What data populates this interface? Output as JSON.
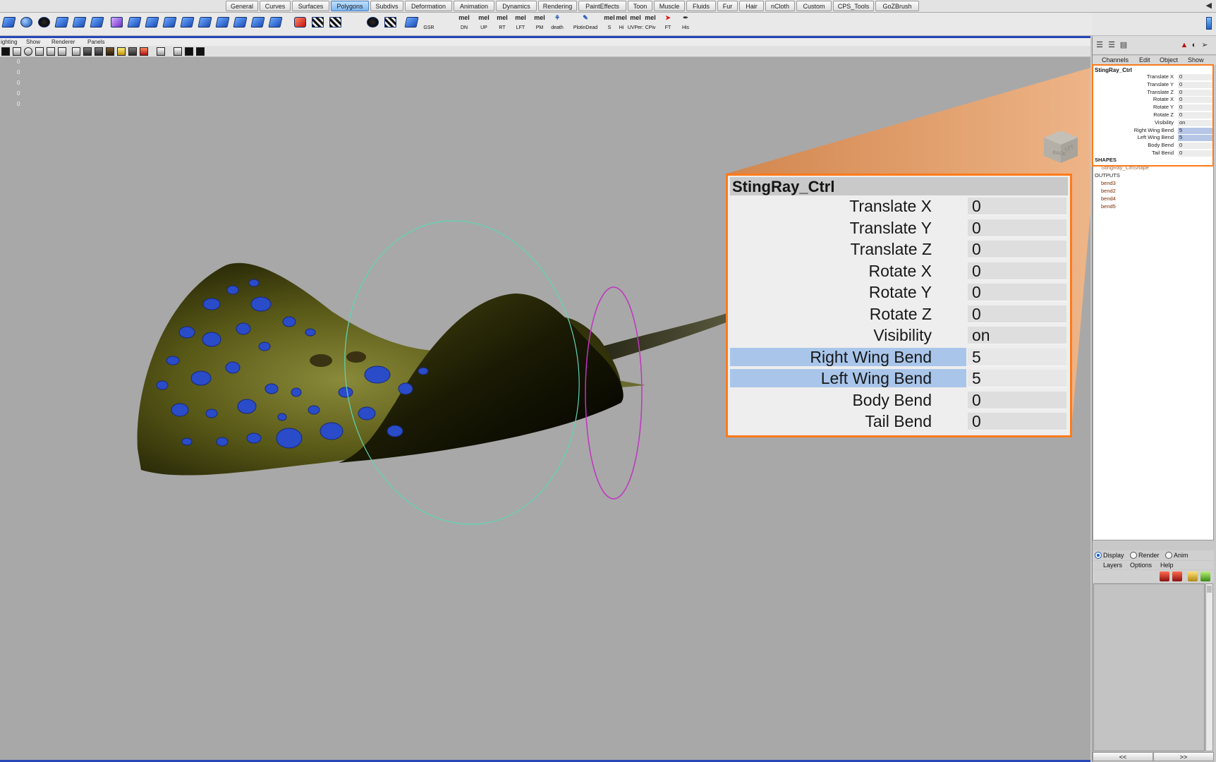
{
  "shelf": {
    "tabs": [
      "General",
      "Curves",
      "Surfaces",
      "Polygons",
      "Subdivs",
      "Deformation",
      "Animation",
      "Dynamics",
      "Rendering",
      "PaintEffects",
      "Toon",
      "Muscle",
      "Fluids",
      "Fur",
      "Hair",
      "nCloth",
      "Custom",
      "CPS_Tools",
      "GoZBrush"
    ],
    "active_tab": "Polygons",
    "tool_captions": [
      "GSR",
      "DN",
      "UP",
      "RT",
      "LFT",
      "PM",
      "death",
      "PlotinDead",
      "S",
      "Hi",
      "UVPer:",
      "CPiv",
      "FT",
      "His"
    ],
    "mel_label": "mel"
  },
  "panel": {
    "menu": [
      "ighting",
      "Show",
      "Renderer",
      "Panels"
    ]
  },
  "viewport": {
    "hud_values": [
      "0",
      "0",
      "0",
      "0",
      "0"
    ],
    "view_cube": {
      "front": "BACK",
      "side": "LFT"
    }
  },
  "channel_box": {
    "menu": [
      "Channels",
      "Edit",
      "Object",
      "Show"
    ],
    "object": "StingRay_Ctrl",
    "attributes": [
      {
        "label": "Translate X",
        "value": "0",
        "highlight": false
      },
      {
        "label": "Translate Y",
        "value": "0",
        "highlight": false
      },
      {
        "label": "Translate Z",
        "value": "0",
        "highlight": false
      },
      {
        "label": "Rotate X",
        "value": "0",
        "highlight": false
      },
      {
        "label": "Rotate Y",
        "value": "0",
        "highlight": false
      },
      {
        "label": "Rotate Z",
        "value": "0",
        "highlight": false
      },
      {
        "label": "Visibility",
        "value": "on",
        "highlight": false
      },
      {
        "label": "Right Wing Bend",
        "value": "5",
        "highlight": true
      },
      {
        "label": "Left Wing Bend",
        "value": "5",
        "highlight": true
      },
      {
        "label": "Body Bend",
        "value": "0",
        "highlight": false
      },
      {
        "label": "Tail Bend",
        "value": "0",
        "highlight": false
      }
    ],
    "shapes_header": "SHAPES",
    "shapes": [
      "StingRay_CtrlShape"
    ],
    "outputs_header": "OUTPUTS",
    "outputs": [
      "bend3",
      "bend2",
      "bend4",
      "bend5"
    ]
  },
  "layer_editor": {
    "modes": [
      {
        "label": "Display",
        "selected": true
      },
      {
        "label": "Render",
        "selected": false
      },
      {
        "label": "Anim",
        "selected": false
      }
    ],
    "menu": [
      "Layers",
      "Options",
      "Help"
    ],
    "nav_prev": "<<",
    "nav_next": ">>"
  },
  "colors": {
    "accent_orange": "#ff7a1a",
    "selection_blue": "#a9c6ea",
    "viewport_bg": "#a8a8a8",
    "active_tab": "#7fb6ef"
  }
}
